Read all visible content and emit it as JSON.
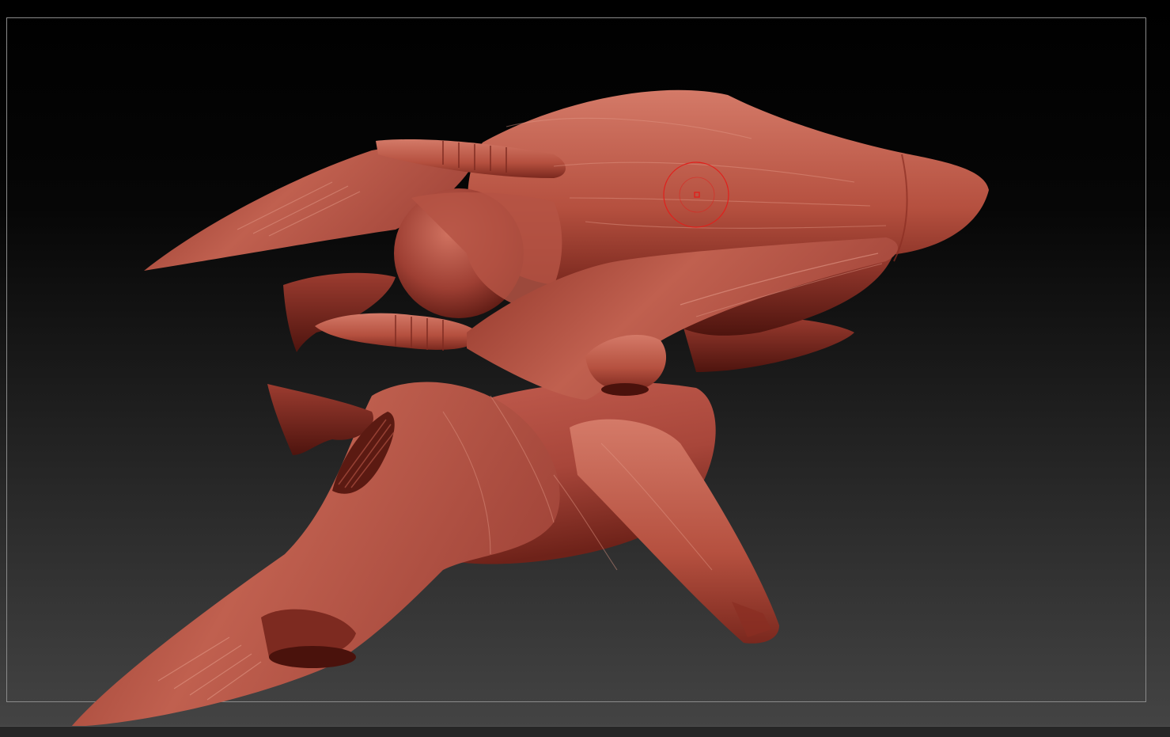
{
  "viewport": {
    "background_top": "#000000",
    "background_bottom": "#454545",
    "frame_color": "#8a8a8a"
  },
  "model": {
    "material_color": "#b3493c",
    "highlight_color": "#d77a68",
    "shadow_color": "#5e1a14",
    "panel_line_color": "#e39a88"
  },
  "brush_cursor": {
    "icon": "brush-cursor-icon",
    "color": "#e0201c"
  }
}
